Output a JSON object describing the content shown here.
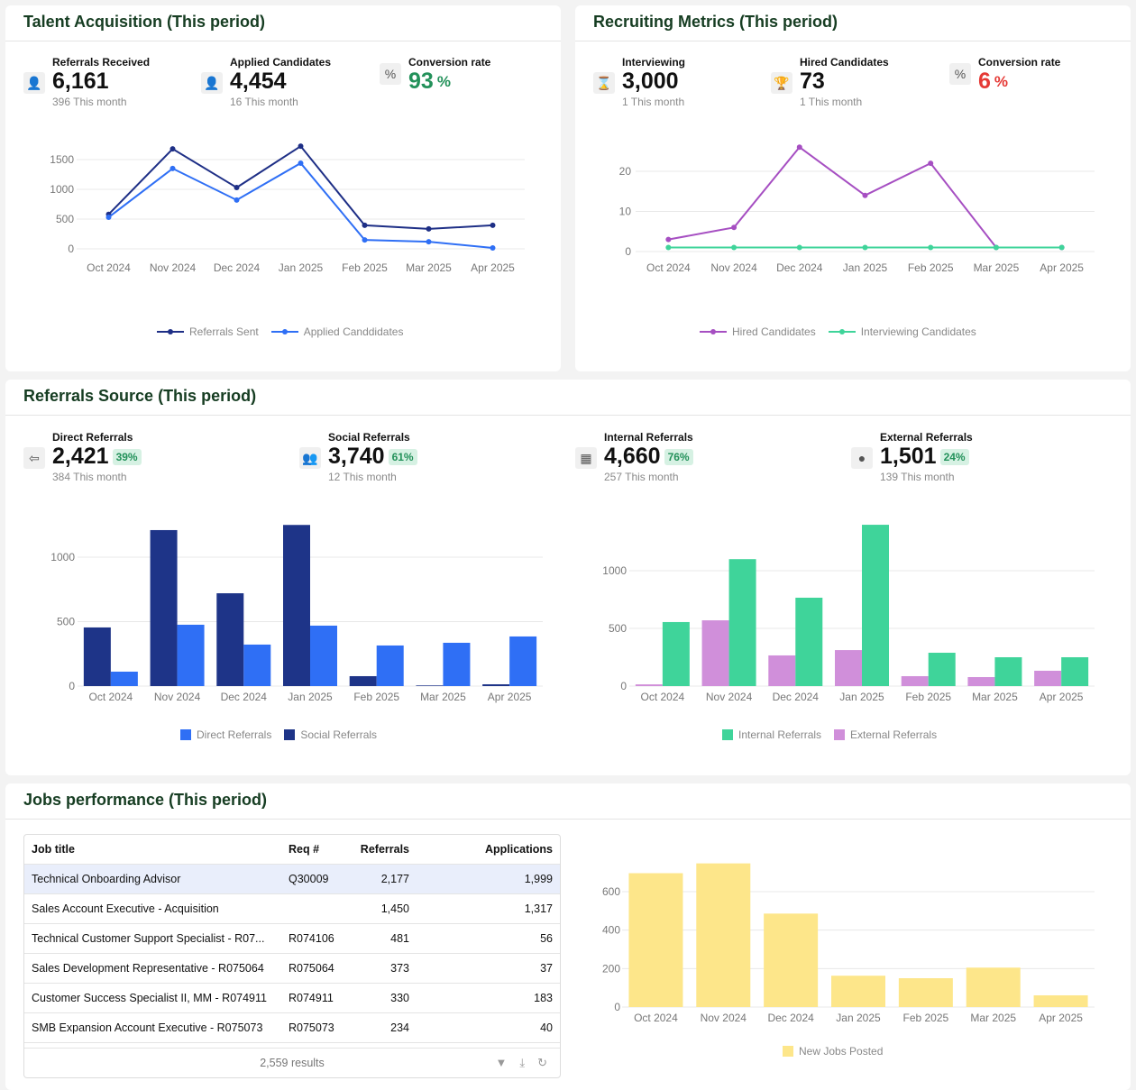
{
  "colors": {
    "title": "#163d22",
    "green": "#23915a",
    "red": "#e53935",
    "navy": "#1e2f86",
    "blue": "#2f6ff5",
    "purple": "#a64fc2",
    "teal": "#3fd49a",
    "lilac": "#d08fda",
    "yellow": "#fde68a"
  },
  "talent": {
    "title": "Talent Acquisition (This period)",
    "kpis": [
      {
        "label": "Referrals Received",
        "value": "6,161",
        "sub": "396 This month",
        "icon": "user-plus-icon"
      },
      {
        "label": "Applied Candidates",
        "value": "4,454",
        "sub": "16 This month",
        "icon": "user-check-icon"
      },
      {
        "label": "Conversion rate",
        "value": "93",
        "unit": "%",
        "icon": "percent-icon"
      }
    ]
  },
  "recruiting": {
    "title": "Recruiting Metrics (This period)",
    "kpis": [
      {
        "label": "Interviewing",
        "value": "3,000",
        "sub": "1 This month",
        "icon": "hourglass-icon"
      },
      {
        "label": "Hired Candidates",
        "value": "73",
        "sub": "1 This month",
        "icon": "trophy-icon"
      },
      {
        "label": "Conversion rate",
        "value": "6",
        "unit": "%",
        "icon": "percent-icon"
      }
    ]
  },
  "sources": {
    "title": "Referrals Source (This period)",
    "kpis": [
      {
        "label": "Direct Referrals",
        "value": "2,421",
        "badge": "39%",
        "sub": "384 This month",
        "icon": "sign-in-icon"
      },
      {
        "label": "Social Referrals",
        "value": "3,740",
        "badge": "61%",
        "sub": "12 This month",
        "icon": "people-icon"
      },
      {
        "label": "Internal Referrals",
        "value": "4,660",
        "badge": "76%",
        "sub": "257 This month",
        "icon": "building-icon"
      },
      {
        "label": "External Referrals",
        "value": "1,501",
        "badge": "24%",
        "sub": "139 This month",
        "icon": "globe-icon"
      }
    ]
  },
  "jobs": {
    "title": "Jobs performance (This period)",
    "columns": [
      "Job title",
      "Req #",
      "Referrals",
      "Applications"
    ],
    "rows": [
      [
        "Technical Onboarding Advisor",
        "Q30009",
        "2,177",
        "1,999"
      ],
      [
        "Sales Account Executive - Acquisition",
        "",
        "1,450",
        "1,317"
      ],
      [
        "Technical Customer Support Specialist - R07...",
        "R074106",
        "481",
        "56"
      ],
      [
        "Sales Development Representative - R075064",
        "R075064",
        "373",
        "37"
      ],
      [
        "Customer Success Specialist II, MM - R074911",
        "R074911",
        "330",
        "183"
      ],
      [
        "SMB Expansion Account Executive - R075073",
        "R075073",
        "234",
        "40"
      ]
    ],
    "results": "2,559 results"
  },
  "chart_data": [
    {
      "type": "line",
      "categories": [
        "Oct 2024",
        "Nov 2024",
        "Dec 2024",
        "Jan 2025",
        "Feb 2025",
        "Mar 2025",
        "Apr 2025"
      ],
      "yticks": [
        0,
        500,
        1000,
        1500
      ],
      "ylim": [
        0,
        1500
      ],
      "grid": true,
      "legend": "bottom",
      "series": [
        {
          "name": "Referrals Sent",
          "color": "#1e2f86",
          "values": [
            580,
            1680,
            1030,
            1725,
            395,
            335,
            395
          ]
        },
        {
          "name": "Applied Canddidates",
          "color": "#2f6ff5",
          "values": [
            530,
            1350,
            820,
            1440,
            150,
            120,
            15
          ]
        }
      ]
    },
    {
      "type": "line",
      "categories": [
        "Oct 2024",
        "Nov 2024",
        "Dec 2024",
        "Jan 2025",
        "Feb 2025",
        "Mar 2025",
        "Apr 2025"
      ],
      "yticks": [
        0,
        10,
        20
      ],
      "ylim": [
        0,
        20
      ],
      "grid": true,
      "legend": "bottom",
      "series": [
        {
          "name": "Hired Candidates",
          "color": "#a64fc2",
          "values": [
            3,
            6,
            26,
            14,
            22,
            1,
            1
          ]
        },
        {
          "name": "Interviewing Candidates",
          "color": "#3fd49a",
          "values": [
            1,
            1,
            1,
            1,
            1,
            1,
            1
          ]
        }
      ]
    },
    {
      "type": "bar",
      "categories": [
        "Oct 2024",
        "Nov 2024",
        "Dec 2024",
        "Jan 2025",
        "Feb 2025",
        "Mar 2025",
        "Apr 2025"
      ],
      "yticks": [
        0,
        500,
        1000
      ],
      "ylim": [
        0,
        1000
      ],
      "grid": true,
      "legend": "bottom",
      "series": [
        {
          "name": "Social Referrals",
          "color": "#1e3488",
          "values": [
            455,
            1210,
            720,
            1250,
            77,
            5,
            14
          ]
        },
        {
          "name": "Direct Referrals",
          "color": "#2f6ff5",
          "values": [
            112,
            476,
            322,
            469,
            315,
            336,
            385
          ]
        }
      ],
      "legend_order": [
        1,
        0
      ]
    },
    {
      "type": "bar",
      "categories": [
        "Oct 2024",
        "Nov 2024",
        "Dec 2024",
        "Jan 2025",
        "Feb 2025",
        "Mar 2025",
        "Apr 2025"
      ],
      "yticks": [
        0,
        500,
        1000
      ],
      "ylim": [
        0,
        1000
      ],
      "grid": true,
      "legend": "bottom",
      "series": [
        {
          "name": "External Referrals",
          "color": "#d08fda",
          "values": [
            15,
            570,
            266,
            312,
            86,
            78,
            133
          ]
        },
        {
          "name": "Internal Referrals",
          "color": "#3fd49a",
          "values": [
            555,
            1100,
            766,
            1398,
            289,
            250,
            250
          ]
        }
      ],
      "legend_order": [
        1,
        0
      ]
    },
    {
      "type": "bar",
      "categories": [
        "Oct 2024",
        "Nov 2024",
        "Dec 2024",
        "Jan 2025",
        "Feb 2025",
        "Mar 2025",
        "Apr 2025"
      ],
      "yticks": [
        0,
        200,
        400,
        600
      ],
      "ylim": [
        0,
        600
      ],
      "grid": true,
      "legend": "bottom",
      "series": [
        {
          "name": "New Jobs Posted",
          "color": "#fde68a",
          "values": [
            696,
            747,
            486,
            163,
            150,
            205,
            61
          ]
        }
      ]
    }
  ]
}
